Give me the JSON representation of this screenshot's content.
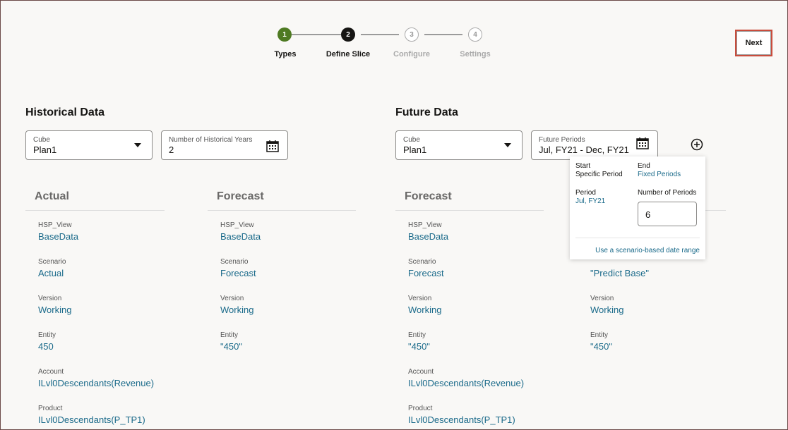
{
  "wizard": {
    "steps": [
      {
        "num": "1",
        "label": "Types",
        "state": "complete"
      },
      {
        "num": "2",
        "label": "Define Slice",
        "state": "current"
      },
      {
        "num": "3",
        "label": "Configure",
        "state": "pending"
      },
      {
        "num": "4",
        "label": "Settings",
        "state": "pending"
      }
    ],
    "next_label": "Next"
  },
  "colors": {
    "complete": "#4e7a22",
    "current": "#161513",
    "link": "#1a6a8a",
    "next_border": "#c94c3c"
  },
  "historical": {
    "title": "Historical Data",
    "cube": {
      "label": "Cube",
      "value": "Plan1"
    },
    "years": {
      "label": "Number of Historical Years",
      "value": "2"
    },
    "actual": {
      "title": "Actual",
      "rows": [
        {
          "label": "HSP_View",
          "value": "BaseData"
        },
        {
          "label": "Scenario",
          "value": "Actual"
        },
        {
          "label": "Version",
          "value": "Working"
        },
        {
          "label": "Entity",
          "value": "450"
        },
        {
          "label": "Account",
          "value": "ILvl0Descendants(Revenue)"
        },
        {
          "label": "Product",
          "value": "ILvl0Descendants(P_TP1)"
        }
      ]
    },
    "forecast": {
      "title": "Forecast",
      "rows": [
        {
          "label": "HSP_View",
          "value": "BaseData"
        },
        {
          "label": "Scenario",
          "value": "Forecast"
        },
        {
          "label": "Version",
          "value": "Working"
        },
        {
          "label": "Entity",
          "value": "\"450\""
        }
      ]
    }
  },
  "future": {
    "title": "Future Data",
    "cube": {
      "label": "Cube",
      "value": "Plan1"
    },
    "periods": {
      "label": "Future Periods",
      "value": "Jul, FY21 - Dec, FY21"
    },
    "forecast": {
      "title": "Forecast",
      "rows": [
        {
          "label": "HSP_View",
          "value": "BaseData"
        },
        {
          "label": "Scenario",
          "value": "Forecast"
        },
        {
          "label": "Version",
          "value": "Working"
        },
        {
          "label": "Entity",
          "value": "\"450\""
        },
        {
          "label": "Account",
          "value": "ILvl0Descendants(Revenue)"
        },
        {
          "label": "Product",
          "value": "ILvl0Descendants(P_TP1)"
        }
      ]
    },
    "second": {
      "rows": [
        {
          "value": "\"Predict Base\""
        },
        {
          "label": "Version",
          "value": "Working"
        },
        {
          "label": "Entity",
          "value": "\"450\""
        }
      ]
    }
  },
  "popover": {
    "start_label": "Start",
    "start_value": "Specific Period",
    "end_label": "End",
    "end_value": "Fixed Periods",
    "period_label": "Period",
    "period_value": "Jul, FY21",
    "num_label": "Number of Periods",
    "num_value": "6",
    "scenario_link": "Use a scenario-based date range"
  }
}
